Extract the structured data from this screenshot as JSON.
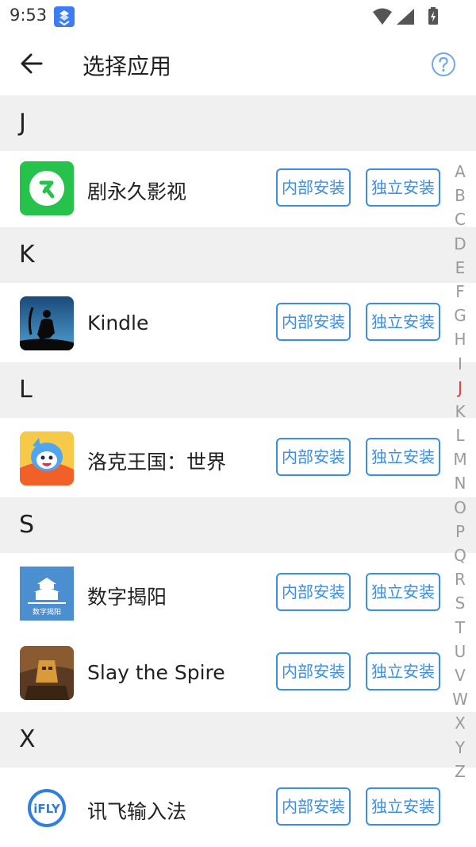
{
  "status_bar": {
    "time": "9:53",
    "app_icon": "notification-app-icon",
    "wifi_icon": "wifi-icon",
    "signal_icon": "signal-icon",
    "battery_icon": "battery-charging-icon"
  },
  "app_bar": {
    "title": "选择应用",
    "back_icon": "arrow-back-icon",
    "help_icon": "help-circle-icon"
  },
  "buttons": {
    "internal_install": "内部安装",
    "standalone_install": "独立安装"
  },
  "colors": {
    "accent": "#3a8ee6",
    "section_bg": "#f0f0f0",
    "index_active": "#e53935",
    "index_inactive": "#9a9a9a"
  },
  "sections": [
    {
      "letter": "J",
      "apps": [
        {
          "name": "剧永久影视",
          "icon": "jyj-video-icon"
        }
      ]
    },
    {
      "letter": "K",
      "apps": [
        {
          "name": "Kindle",
          "icon": "kindle-icon"
        }
      ]
    },
    {
      "letter": "L",
      "apps": [
        {
          "name": "洛克王国：世界",
          "icon": "roco-kingdom-icon"
        }
      ]
    },
    {
      "letter": "S",
      "apps": [
        {
          "name": "数字揭阳",
          "icon": "digital-jieyang-icon",
          "icon_text": "数字揭阳"
        },
        {
          "name": "Slay the Spire",
          "icon": "slay-the-spire-icon"
        }
      ]
    },
    {
      "letter": "X",
      "apps": [
        {
          "name": "讯飞输入法",
          "icon": "ifly-input-icon",
          "icon_text": "iFLY"
        }
      ]
    }
  ],
  "index_bar": {
    "letters": [
      "A",
      "B",
      "C",
      "D",
      "E",
      "F",
      "G",
      "H",
      "I",
      "J",
      "K",
      "L",
      "M",
      "N",
      "O",
      "P",
      "Q",
      "R",
      "S",
      "T",
      "U",
      "V",
      "W",
      "X",
      "Y",
      "Z"
    ],
    "active": "J"
  }
}
